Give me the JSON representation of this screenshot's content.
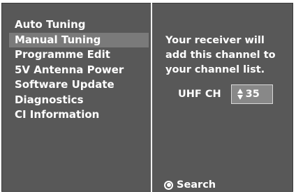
{
  "menu": {
    "items": [
      {
        "label": "Auto Tuning"
      },
      {
        "label": "Manual Tuning",
        "selected": true
      },
      {
        "label": "Programme Edit"
      },
      {
        "label": "5V Antenna Power"
      },
      {
        "label": "Software Update"
      },
      {
        "label": "Diagnostics"
      },
      {
        "label": "CI Information"
      }
    ]
  },
  "panel": {
    "message_lines": [
      "Your receiver will",
      "add this channel to",
      "your channel list."
    ],
    "channel": {
      "label": "UHF CH",
      "value": "35",
      "icon": "up-down-arrows-icon"
    },
    "search": {
      "label": "Search",
      "icon": "radio-selected-icon"
    }
  },
  "colors": {
    "background": "#585858",
    "selected_item": "#7a7a7a",
    "stepper": "#888888",
    "text": "#ffffff",
    "divider": "#f2f2f2"
  }
}
